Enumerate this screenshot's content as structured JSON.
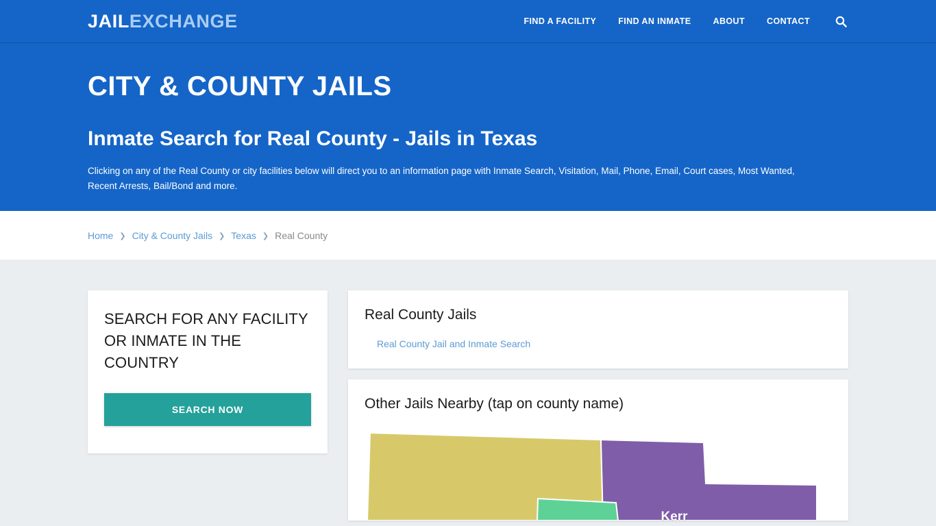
{
  "header": {
    "logo_primary": "JAIL",
    "logo_secondary": "EXCHANGE",
    "nav": [
      {
        "label": "FIND A FACILITY"
      },
      {
        "label": "FIND AN INMATE"
      },
      {
        "label": "ABOUT"
      },
      {
        "label": "CONTACT"
      }
    ],
    "search_icon": "search-icon",
    "background_color": "#1565c8"
  },
  "hero": {
    "eyebrow": "CITY & COUNTY JAILS",
    "title": "Inmate Search for Real County - Jails in Texas",
    "description": "Clicking on any of the Real County or city facilities below will direct you to an information page with Inmate Search, Visitation, Mail, Phone, Email, Court cases, Most Wanted, Recent Arrests, Bail/Bond and more.",
    "background_color": "#1565c8"
  },
  "breadcrumb": {
    "separator": "❯",
    "items": [
      {
        "label": "Home",
        "is_link": true
      },
      {
        "label": "City & County Jails",
        "is_link": true
      },
      {
        "label": "Texas",
        "is_link": true
      },
      {
        "label": "Real County",
        "is_link": false
      }
    ],
    "link_color": "#5b9bd5",
    "current_color": "#86888a"
  },
  "search_card": {
    "title": "SEARCH FOR ANY FACILITY OR INMATE IN THE COUNTRY",
    "button_label": "SEARCH NOW",
    "button_color": "#23a19a"
  },
  "jails_card": {
    "title": "Real County Jails",
    "links": [
      {
        "label": "Real County Jail and Inmate Search"
      }
    ],
    "link_color": "#5b9bd5"
  },
  "nearby_card": {
    "title": "Other Jails Nearby (tap on county name)",
    "map": {
      "counties": [
        {
          "name": "",
          "color": "#d7c96a",
          "data_name": "county-polygon-yellow"
        },
        {
          "name": "Kerr",
          "color": "#7f5da8",
          "data_name": "county-polygon-kerr"
        },
        {
          "name": "",
          "color": "#5ed197",
          "data_name": "county-polygon-green"
        }
      ],
      "visible_label": "Kerr"
    }
  },
  "page_background": "#eaeef0"
}
